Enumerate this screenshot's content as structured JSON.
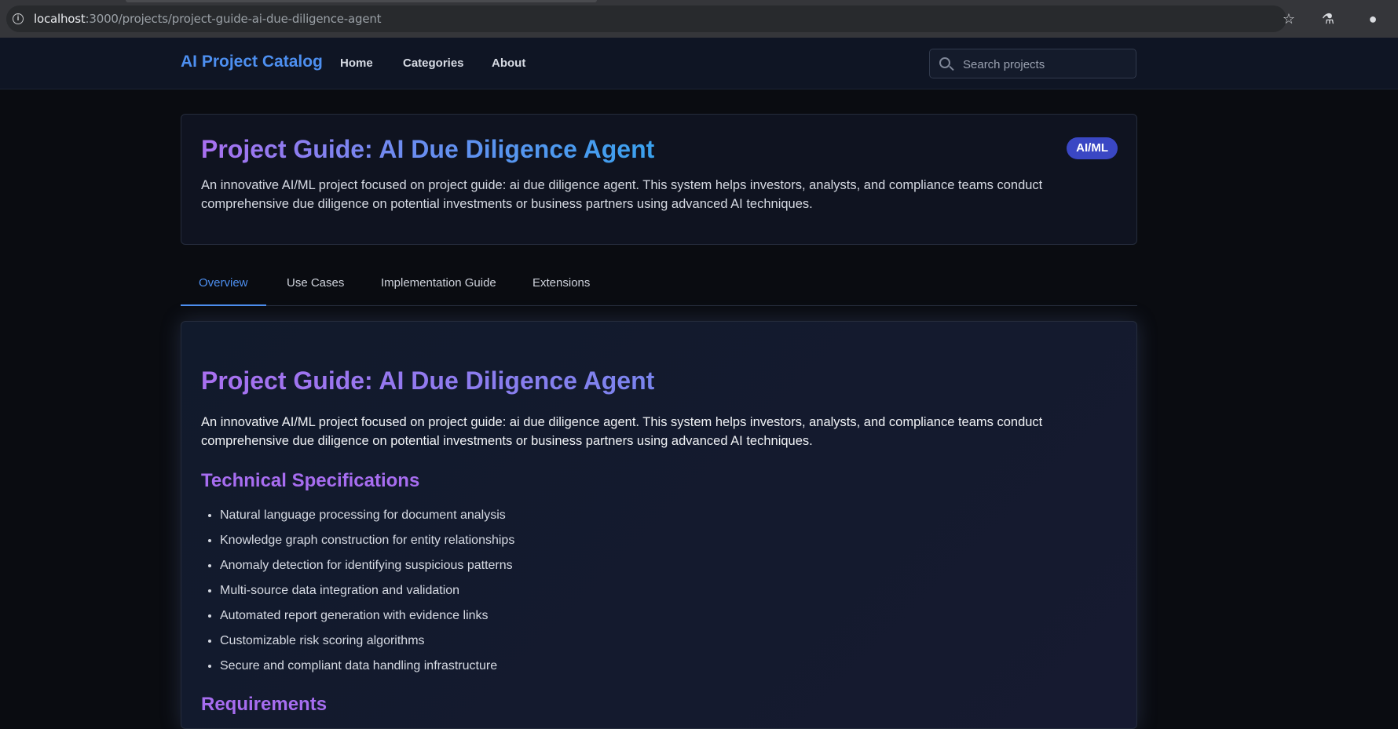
{
  "browser": {
    "url_host": "localhost",
    "url_rest": ":3000/projects/project-guide-ai-due-diligence-agent",
    "icons": [
      "info-icon",
      "star-icon",
      "labs-icon",
      "profile-icon"
    ]
  },
  "header": {
    "brand": "AI Project Catalog",
    "nav": [
      "Home",
      "Categories",
      "About"
    ],
    "search_placeholder": "Search projects"
  },
  "hero": {
    "title": "Project Guide: AI Due Diligence Agent",
    "badge": "AI/ML",
    "description": "An innovative AI/ML project focused on project guide: ai due diligence agent. This system helps investors, analysts, and compliance teams conduct comprehensive due diligence on potential investments or business partners using advanced AI techniques."
  },
  "tabs": [
    "Overview",
    "Use Cases",
    "Implementation Guide",
    "Extensions"
  ],
  "active_tab": "Overview",
  "content": {
    "title": "Project Guide: AI Due Diligence Agent",
    "description": "An innovative AI/ML project focused on project guide: ai due diligence agent. This system helps investors, analysts, and compliance teams conduct comprehensive due diligence on potential investments or business partners using advanced AI techniques.",
    "tech_heading": "Technical Specifications",
    "tech_specs": [
      "Natural language processing for document analysis",
      "Knowledge graph construction for entity relationships",
      "Anomaly detection for identifying suspicious patterns",
      "Multi-source data integration and validation",
      "Automated report generation with evidence links",
      "Customizable risk scoring algorithms",
      "Secure and compliant data handling infrastructure"
    ],
    "next_heading": "Requirements"
  },
  "colors": {
    "accent": "#4d8ff0",
    "badge": "#3a47c4",
    "heading_purple": "#a76df0",
    "background": "#0a0c11"
  }
}
